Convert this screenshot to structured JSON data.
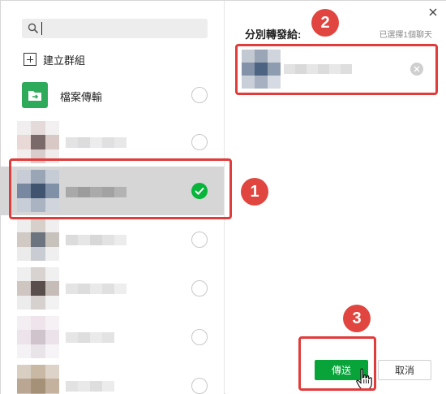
{
  "search": {
    "placeholder": ""
  },
  "create_group": {
    "label": "建立群組"
  },
  "file_transfer": {
    "label": "檔案傳輸"
  },
  "right": {
    "title": "分別轉發給:",
    "selected_count": "已選擇1個聊天"
  },
  "buttons": {
    "send": "傳送",
    "cancel": "取消"
  },
  "annotations": {
    "step1": "1",
    "step2": "2",
    "step3": "3"
  },
  "colors": {
    "accent_green": "#08a43a",
    "selection_bg": "#d6d6d6",
    "annotation_red": "#e03c3c"
  },
  "icons": {
    "search": "search-icon",
    "close": "close-icon",
    "check": "check-icon",
    "remove": "remove-circle-icon",
    "file_transfer": "file-transfer-icon",
    "plus": "plus-square-icon",
    "cursor": "hand-pointer-icon"
  },
  "contacts": [
    {
      "name": ""
    },
    {
      "name": "",
      "selected": true
    },
    {
      "name": ""
    },
    {
      "name": ""
    },
    {
      "name": ""
    },
    {
      "name": ""
    }
  ]
}
